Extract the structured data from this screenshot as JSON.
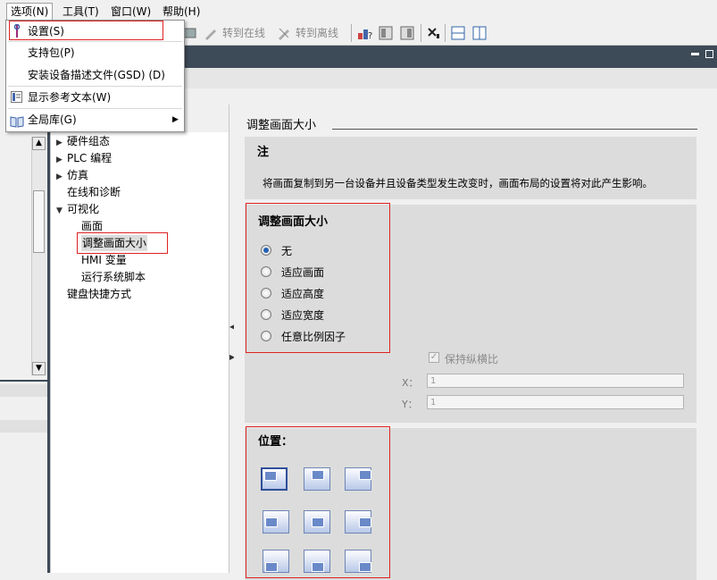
{
  "menubar": {
    "items": [
      "选项(N)",
      "工具(T)",
      "窗口(W)",
      "帮助(H)"
    ]
  },
  "toolbar": {
    "go_online": "转到在线",
    "go_offline": "转到离线"
  },
  "dropdown": {
    "items": [
      {
        "label": "设置(S)",
        "icon": "wrench-icon"
      },
      {
        "label": "支持包(P)"
      },
      {
        "label": "安装设备描述文件(GSD) (D)"
      },
      {
        "label": "显示参考文本(W)",
        "icon": "reference-text-icon"
      },
      {
        "label": "全局库(G)",
        "icon": "book-icon",
        "submenu": true
      }
    ]
  },
  "tree": {
    "items": [
      {
        "label": "硬件组态",
        "caret": "▶"
      },
      {
        "label": "PLC 编程",
        "caret": "▶"
      },
      {
        "label": "仿真",
        "caret": "▶"
      },
      {
        "label": "在线和诊断",
        "caret": ""
      },
      {
        "label": "可视化",
        "caret": "▼"
      },
      {
        "label": "画面",
        "caret": ""
      },
      {
        "label": "调整画面大小",
        "caret": "",
        "selected": true
      },
      {
        "label": "HMI 变量",
        "caret": ""
      },
      {
        "label": "运行系统脚本",
        "caret": ""
      },
      {
        "label": "键盘快捷方式",
        "caret": ""
      }
    ]
  },
  "panel": {
    "title": "调整画面大小",
    "note_title": "注",
    "note_text": "将画面复制到另一台设备并且设备类型发生改变时，画面布局的设置将对此产生影响。",
    "resize_title": "调整画面大小",
    "resize_options": [
      "无",
      "适应画面",
      "适应高度",
      "适应宽度",
      "任意比例因子"
    ],
    "resize_selected": "无",
    "keep_aspect": "保持纵横比",
    "x_label": "X：",
    "x_value": "1",
    "y_label": "Y：",
    "y_value": "1",
    "position_title": "位置："
  },
  "colors": {
    "accent": "#2461b2",
    "highlight_border": "#d22222",
    "dark_bar": "#3d4a58"
  }
}
